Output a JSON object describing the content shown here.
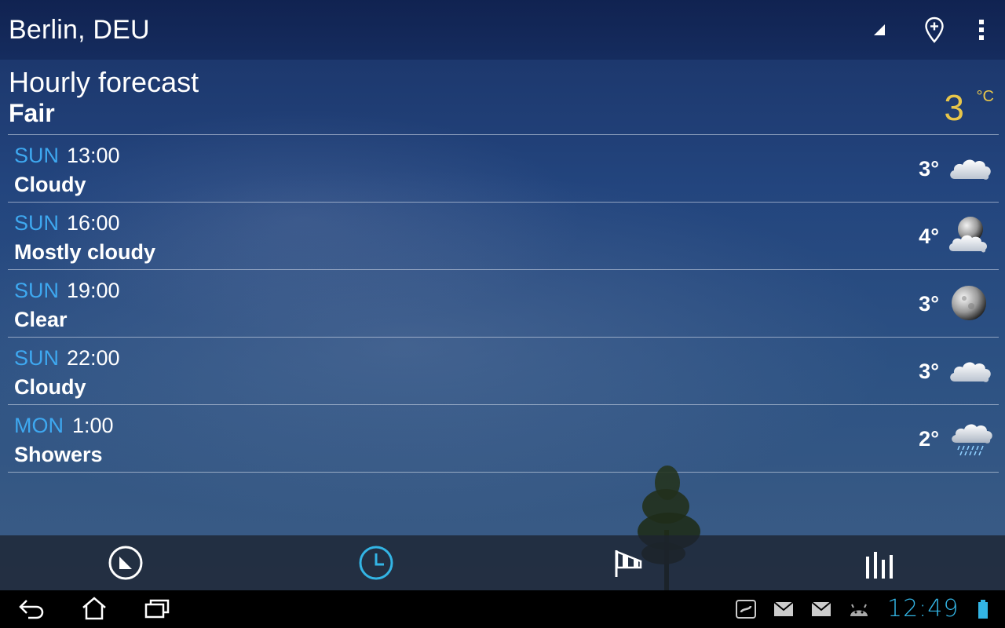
{
  "header": {
    "location": "Berlin, DEU"
  },
  "section": {
    "title": "Hourly forecast",
    "condition": "Fair",
    "current_temp": "3",
    "current_unit": "°C"
  },
  "forecast": [
    {
      "day": "SUN",
      "time": "13:00",
      "condition": "Cloudy",
      "temp": "3°",
      "icon": "cloud-icon"
    },
    {
      "day": "SUN",
      "time": "16:00",
      "condition": "Mostly cloudy",
      "temp": "4°",
      "icon": "moon-cloud-icon"
    },
    {
      "day": "SUN",
      "time": "19:00",
      "condition": "Clear",
      "temp": "3°",
      "icon": "moon-icon"
    },
    {
      "day": "SUN",
      "time": "22:00",
      "condition": "Cloudy",
      "temp": "3°",
      "icon": "cloud-icon"
    },
    {
      "day": "MON",
      "time": "1:00",
      "condition": "Showers",
      "temp": "2°",
      "icon": "rain-cloud-icon"
    }
  ],
  "tabs": [
    {
      "name": "current-conditions-tab",
      "icon": "compass-icon"
    },
    {
      "name": "hourly-tab",
      "icon": "clock-icon",
      "active": true
    },
    {
      "name": "wind-tab",
      "icon": "windsock-icon"
    },
    {
      "name": "daily-tab",
      "icon": "bars-icon"
    }
  ],
  "system": {
    "clock": "12:49"
  },
  "colors": {
    "accent": "#33b5e5",
    "day_label": "#3ea8f0",
    "temp_highlight": "#e8c64a"
  }
}
